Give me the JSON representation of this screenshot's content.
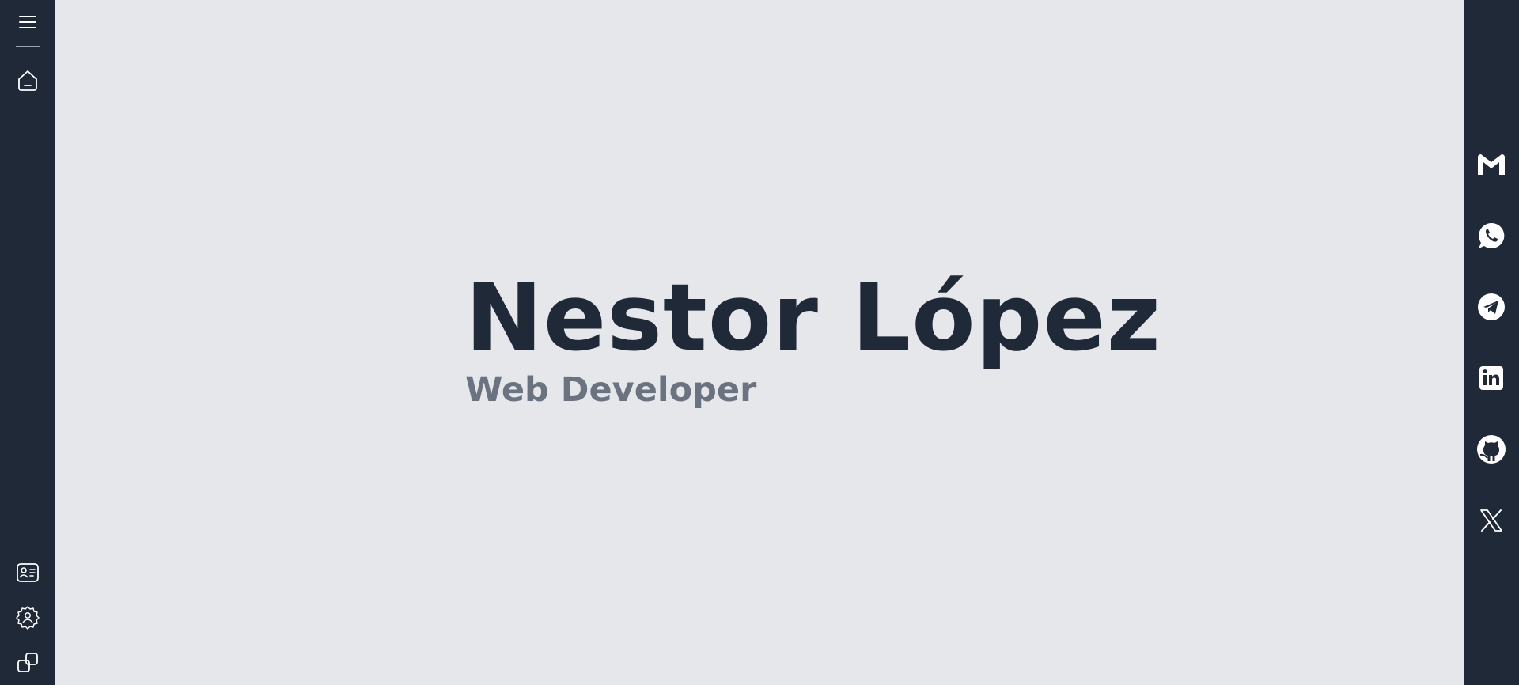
{
  "hero": {
    "name": "Nestor López",
    "role": "Web Developer"
  },
  "left_nav": {
    "top": [
      {
        "icon": "menu-icon"
      },
      {
        "icon": "home-icon"
      }
    ],
    "bottom": [
      {
        "icon": "contact-card-icon"
      },
      {
        "icon": "settings-user-icon"
      },
      {
        "icon": "projects-icon"
      }
    ]
  },
  "social_links": [
    {
      "icon": "gmail-icon"
    },
    {
      "icon": "whatsapp-icon"
    },
    {
      "icon": "telegram-icon"
    },
    {
      "icon": "linkedin-icon"
    },
    {
      "icon": "github-icon"
    },
    {
      "icon": "x-icon"
    }
  ],
  "colors": {
    "rail": "#1f2937",
    "background": "#e5e7eb",
    "name": "#1f2937",
    "role": "#6b7280"
  }
}
